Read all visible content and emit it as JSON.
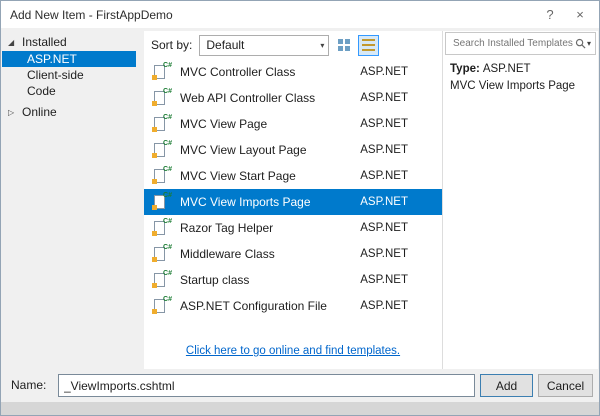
{
  "window": {
    "title": "Add New Item - FirstAppDemo",
    "help_label": "?",
    "close_label": "×"
  },
  "icons": {
    "expanded_triangle": "◢",
    "collapsed_triangle": "▷",
    "chevron_down": "▾",
    "csharp_badge": "C#"
  },
  "sidebar": {
    "sections": [
      {
        "label": "Installed",
        "expanded": true,
        "items": [
          {
            "label": "ASP.NET",
            "selected": true
          },
          {
            "label": "Client-side",
            "selected": false
          },
          {
            "label": "Code",
            "selected": false
          }
        ]
      },
      {
        "label": "Online",
        "expanded": false,
        "items": []
      }
    ]
  },
  "toolbar": {
    "sort_label": "Sort by:",
    "sort_value": "Default"
  },
  "templates": {
    "selected_index": 5,
    "online_link": "Click here to go online and find templates.",
    "items": [
      {
        "name": "MVC Controller Class",
        "platform": "ASP.NET",
        "icon": "csharp-class-file"
      },
      {
        "name": "Web API Controller Class",
        "platform": "ASP.NET",
        "icon": "csharp-class-file"
      },
      {
        "name": "MVC View Page",
        "platform": "ASP.NET",
        "icon": "csharp-view-file"
      },
      {
        "name": "MVC View Layout Page",
        "platform": "ASP.NET",
        "icon": "csharp-view-file"
      },
      {
        "name": "MVC View Start Page",
        "platform": "ASP.NET",
        "icon": "csharp-view-file"
      },
      {
        "name": "MVC View Imports Page",
        "platform": "ASP.NET",
        "icon": "csharp-view-file"
      },
      {
        "name": "Razor Tag Helper",
        "platform": "ASP.NET",
        "icon": "csharp-class-file"
      },
      {
        "name": "Middleware Class",
        "platform": "ASP.NET",
        "icon": "csharp-class-file"
      },
      {
        "name": "Startup class",
        "platform": "ASP.NET",
        "icon": "csharp-class-file"
      },
      {
        "name": "ASP.NET Configuration File",
        "platform": "ASP.NET",
        "icon": "config-file"
      }
    ]
  },
  "right_panel": {
    "search_placeholder": "Search Installed Templates (Ctrl+E)",
    "type_label": "Type:",
    "type_value": "ASP.NET",
    "description": "MVC View Imports Page"
  },
  "footer": {
    "name_label": "Name:",
    "name_value": "_ViewImports.cshtml",
    "add_label": "Add",
    "cancel_label": "Cancel"
  },
  "colors": {
    "selection": "#007acc",
    "link": "#0066cc"
  }
}
